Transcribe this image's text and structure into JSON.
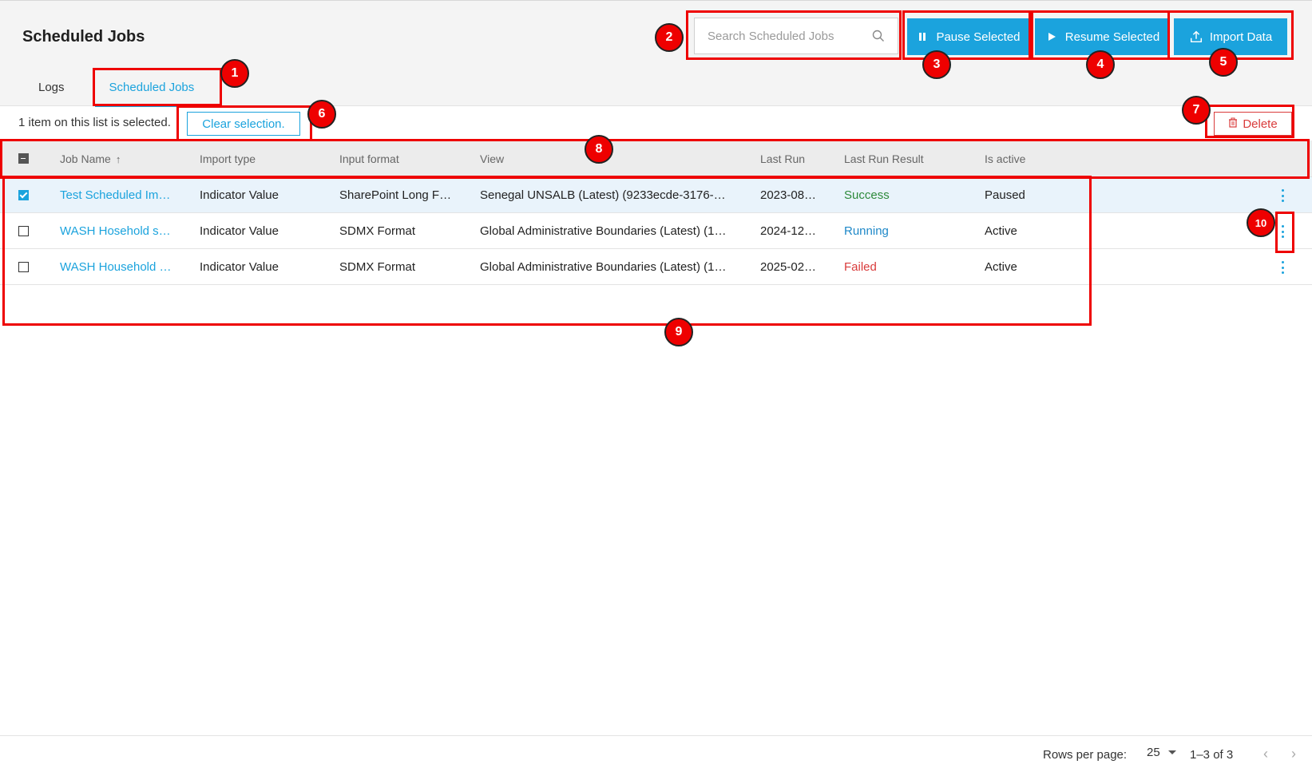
{
  "header": {
    "title": "Scheduled Jobs",
    "search": {
      "placeholder": "Search Scheduled Jobs",
      "value": "",
      "icon": "search-icon"
    },
    "buttons": {
      "pause": {
        "label": "Pause Selected",
        "icon": "pause-icon"
      },
      "resume": {
        "label": "Resume Selected",
        "icon": "play-icon"
      },
      "import": {
        "label": "Import Data",
        "icon": "upload-icon"
      }
    },
    "accent_color": "#1ba3dd"
  },
  "tabs": [
    {
      "label": "Logs",
      "active": false
    },
    {
      "label": "Scheduled Jobs",
      "active": true
    }
  ],
  "selection": {
    "text": "1 item on this list is selected.",
    "clear_label": "Clear selection.",
    "delete_label": "Delete",
    "delete_icon": "trash-icon"
  },
  "table": {
    "columns": [
      "Job Name",
      "Import type",
      "Input format",
      "View",
      "Last Run",
      "Last Run Result",
      "Is active"
    ],
    "sort": {
      "column": "Job Name",
      "direction": "ascending",
      "icon": "arrow-up-icon"
    },
    "rows": [
      {
        "selected": true,
        "job_name": "Test Scheduled Im…",
        "import_type": "Indicator Value",
        "input_format": "SharePoint Long F…",
        "view": "Senegal UNSALB (Latest) (9233ecde-3176-…",
        "last_run": "2023-08…",
        "result": "Success",
        "result_status": "success",
        "is_active": "Paused"
      },
      {
        "selected": false,
        "job_name": "WASH Hosehold s…",
        "import_type": "Indicator Value",
        "input_format": "SDMX Format",
        "view": "Global Administrative Boundaries (Latest) (1…",
        "last_run": "2024-12…",
        "result": "Running",
        "result_status": "running",
        "is_active": "Active"
      },
      {
        "selected": false,
        "job_name": "WASH Household …",
        "import_type": "Indicator Value",
        "input_format": "SDMX Format",
        "view": "Global Administrative Boundaries (Latest) (1…",
        "last_run": "2025-02…",
        "result": "Failed",
        "result_status": "failed",
        "is_active": "Active"
      }
    ]
  },
  "pagination": {
    "rows_per_page_label": "Rows per page:",
    "rows_per_page_value": "25",
    "range_text": "1–3 of 3"
  },
  "annotations": [
    "1",
    "2",
    "3",
    "4",
    "5",
    "6",
    "7",
    "8",
    "9",
    "10"
  ]
}
